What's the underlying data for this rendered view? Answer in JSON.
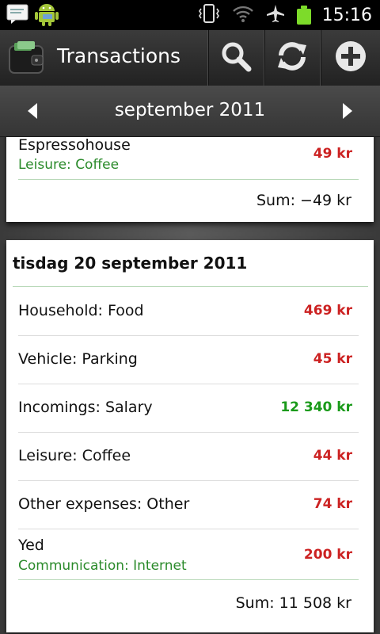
{
  "status": {
    "time": "15:16"
  },
  "actionbar": {
    "title": "Transactions"
  },
  "month": {
    "label": "september 2011"
  },
  "partial_card": {
    "merchant": "Espressohouse",
    "category": "Leisure: Coffee",
    "amount": "49 kr",
    "sum": "Sum: −49 kr"
  },
  "day": {
    "title": "tisdag 20 september 2011",
    "rows": [
      {
        "label": "Household: Food",
        "amount": "469 kr"
      },
      {
        "label": "Vehicle: Parking",
        "amount": "45 kr"
      },
      {
        "label": "Incomings: Salary",
        "amount": "12 340 kr"
      },
      {
        "label": "Leisure: Coffee",
        "amount": "44 kr"
      },
      {
        "label": "Other expenses: Other",
        "amount": "74 kr"
      },
      {
        "label": "Yed",
        "sub": "Communication: Internet",
        "amount": "200 kr"
      }
    ],
    "sum": "Sum: 11 508 kr"
  },
  "colors": {
    "negative": "#cc2222",
    "positive": "#1a9a1a",
    "category": "#2a8a2a"
  }
}
